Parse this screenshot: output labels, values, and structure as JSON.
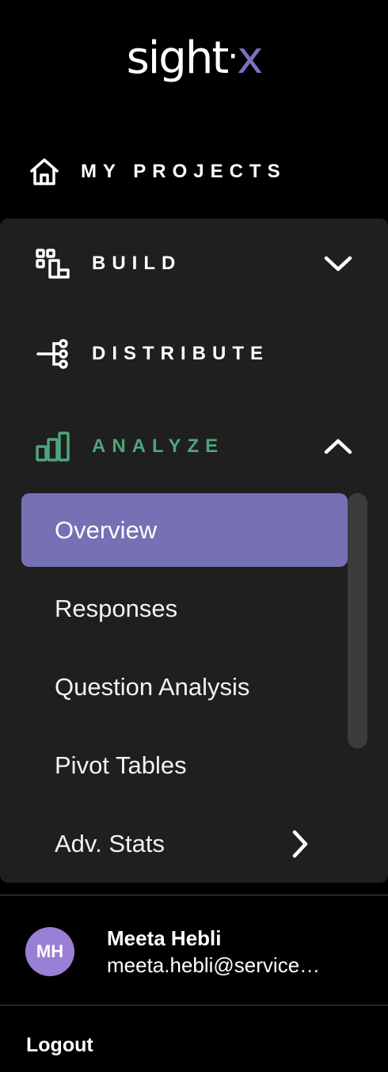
{
  "brand": {
    "logo_main": "sight",
    "logo_dot": "·",
    "logo_x": "x",
    "accent_color": "#7670b5",
    "analyze_color": "#4fa57a"
  },
  "nav": {
    "my_projects": {
      "label": "MY PROJECTS",
      "icon": "home-icon"
    },
    "build": {
      "label": "BUILD",
      "icon": "build-icon",
      "chevron": "chevron-down-icon"
    },
    "distribute": {
      "label": "DISTRIBUTE",
      "icon": "distribute-icon"
    },
    "analyze": {
      "label": "ANALYZE",
      "icon": "bar-chart-icon",
      "chevron": "chevron-up-icon",
      "expanded": true,
      "items": [
        {
          "label": "Overview",
          "active": true
        },
        {
          "label": "Responses"
        },
        {
          "label": "Question Analysis"
        },
        {
          "label": "Pivot Tables"
        },
        {
          "label": "Adv. Stats",
          "icon": "chevron-right-icon"
        }
      ]
    }
  },
  "user": {
    "initials": "MH",
    "name": "Meeta Hebli",
    "email": "meeta.hebli@service…"
  },
  "logout_label": "Logout"
}
